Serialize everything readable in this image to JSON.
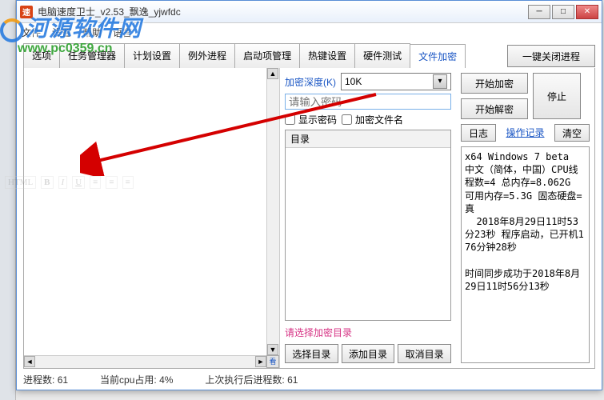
{
  "window": {
    "title": "电脑速度卫士_v2.53_飘逸_yjwfdc"
  },
  "menubar": [
    "文件",
    "设置",
    "帮助",
    "语言"
  ],
  "watermark": {
    "text": "河源软件网",
    "url": "www.pc0359.cn"
  },
  "tabs": [
    "选项",
    "任务管理器",
    "计划设置",
    "例外进程",
    "启动项管理",
    "热键设置",
    "硬件测试",
    "文件加密"
  ],
  "active_tab_index": 7,
  "one_click_btn": "一键关闭进程",
  "encrypt": {
    "depth_label": "加密深度(K)",
    "depth_value": "10K",
    "pwd_placeholder": "请输入密码",
    "show_pwd": "显示密码",
    "enc_filename": "加密文件名",
    "dir_header": "目录",
    "select_hint": "请选择加密目录",
    "btn_select": "选择目录",
    "btn_add": "添加目录",
    "btn_cancel": "取消目录"
  },
  "right": {
    "start_enc": "开始加密",
    "start_dec": "开始解密",
    "stop": "停止",
    "log_btn": "日志",
    "op_record": "操作记录",
    "clear": "清空",
    "log_text": "x64 Windows 7 beta  中文（简体，中国）CPU线程数=4 总内存=8.062G 可用内存=5.3G 固态硬盘=真\n  2018年8月29日11时53分23秒 程序启动，已开机176分钟28秒\n\n时间同步成功于2018年8月29日11时56分13秒"
  },
  "status": {
    "proc_count_label": "进程数:",
    "proc_count": "61",
    "cpu_label": "当前cpu占用:",
    "cpu": "4%",
    "last_label": "上次执行后进程数:",
    "last": "61"
  }
}
